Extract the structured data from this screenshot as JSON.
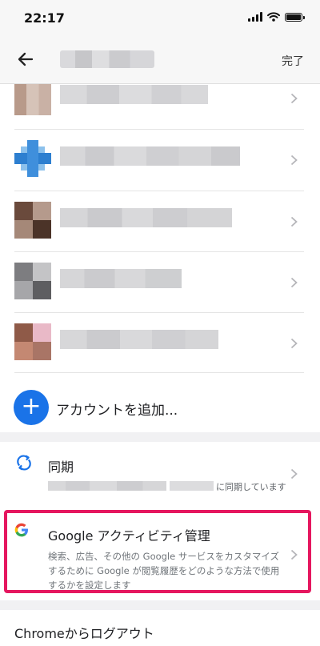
{
  "status_bar": {
    "time": "22:17"
  },
  "header": {
    "done_label": "完了"
  },
  "add_account": {
    "label": "アカウントを追加..."
  },
  "sync": {
    "title": "同期",
    "description": "に同期しています"
  },
  "activity": {
    "title": "Google アクティビティ管理",
    "description": "検索、広告、その他の Google サービスをカスタマイズするために Google が閲覧履歴をどのような方法で使用するかを設定します"
  },
  "logout": {
    "label": "Chromeからログアウト"
  },
  "colors": {
    "accent_blue": "#1a73e8",
    "highlight_pink": "#e5175f"
  }
}
